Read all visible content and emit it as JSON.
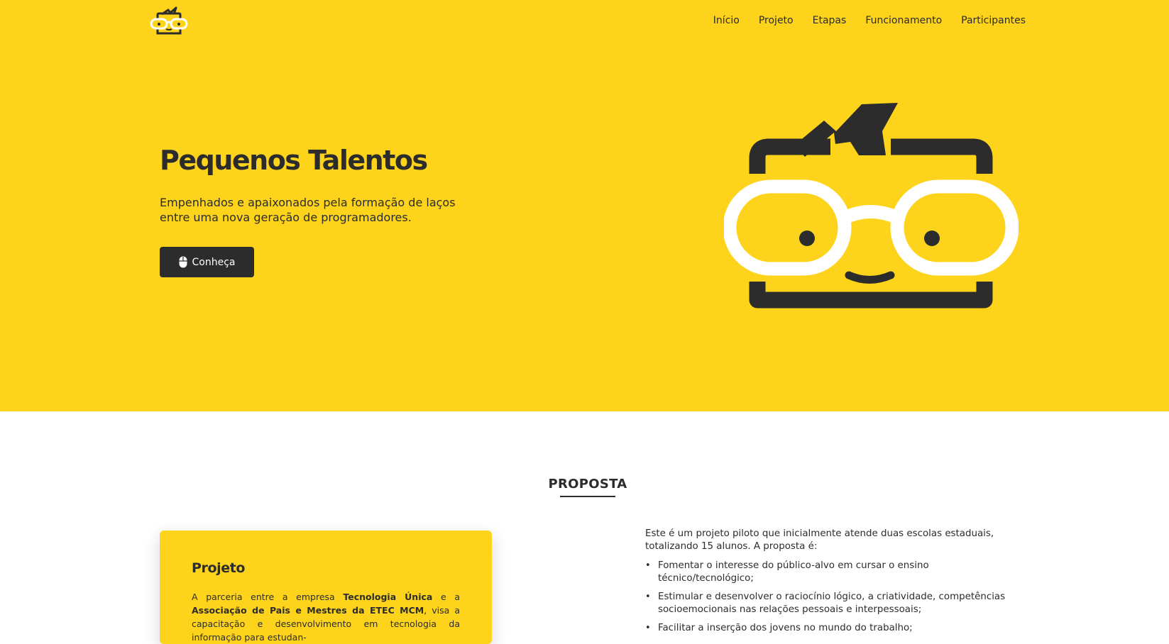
{
  "header": {
    "logo_icon": "nerd-face-logo-icon",
    "nav": [
      "Início",
      "Projeto",
      "Etapas",
      "Funcionamento",
      "Participantes"
    ]
  },
  "hero": {
    "title": "Pequenos Talentos",
    "subtitle": "Empenhados e apaixonados pela formação de laços entre uma nova geração de programadores.",
    "cta_label": "Conheça",
    "cta_icon": "mouse-icon",
    "illustration": "nerd-face-mascot",
    "background_color": "#fdd41b",
    "ink_color": "#2c2c2c"
  },
  "proposta": {
    "section_title": "PROPOSTA",
    "card": {
      "title": "Projeto",
      "text_1": "A parceria entre a empresa ",
      "bold_1": "Tecnologia Única",
      "text_2": " e a ",
      "bold_2": "Associação de Pais e Mestres da ETEC MCM",
      "text_3": ", visa a capacitação e de­senvolvimento em tecnologia da informação para estudan-"
    },
    "intro": "Este é um projeto piloto que inicialmente atende duas escolas estaduais, totalizan­do 15 alunos. A proposta é:",
    "items": [
      "Fomentar o interesse do público-alvo em cursar o ensino técnico/tecnológico;",
      "Estimular e desenvolver o raciocínio lógico, a criatividade, competências socio­emocionais nas relações pessoais e interpessoais;",
      "Facilitar a inserção dos jovens no mundo do trabalho;"
    ]
  }
}
